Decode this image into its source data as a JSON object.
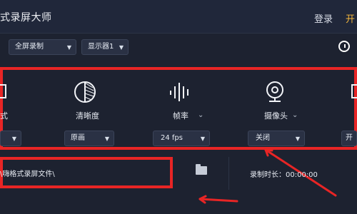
{
  "header": {
    "title": "式录屏大师",
    "login": "登录",
    "open": "开"
  },
  "toolbar": {
    "mode": "全屏录制",
    "display": "显示器1"
  },
  "settings": [
    {
      "label": "式",
      "value": ""
    },
    {
      "label": "清晰度",
      "value": "原画"
    },
    {
      "label": "帧率",
      "value": "24 fps"
    },
    {
      "label": "摄像头",
      "value": "关闭"
    },
    {
      "label": "",
      "value": "开"
    }
  ],
  "path": "\\嗨格式录屏文件\\",
  "record_time": "录制时长：00:00:00",
  "colors": {
    "background": "#1d2230",
    "panel": "#20273a",
    "accent": "#e82525",
    "open": "#f2b63c"
  },
  "icons": [
    "clock-icon",
    "quality-icon",
    "frame-rate-icon",
    "camera-icon",
    "folder-icon",
    "arrow-icon"
  ]
}
